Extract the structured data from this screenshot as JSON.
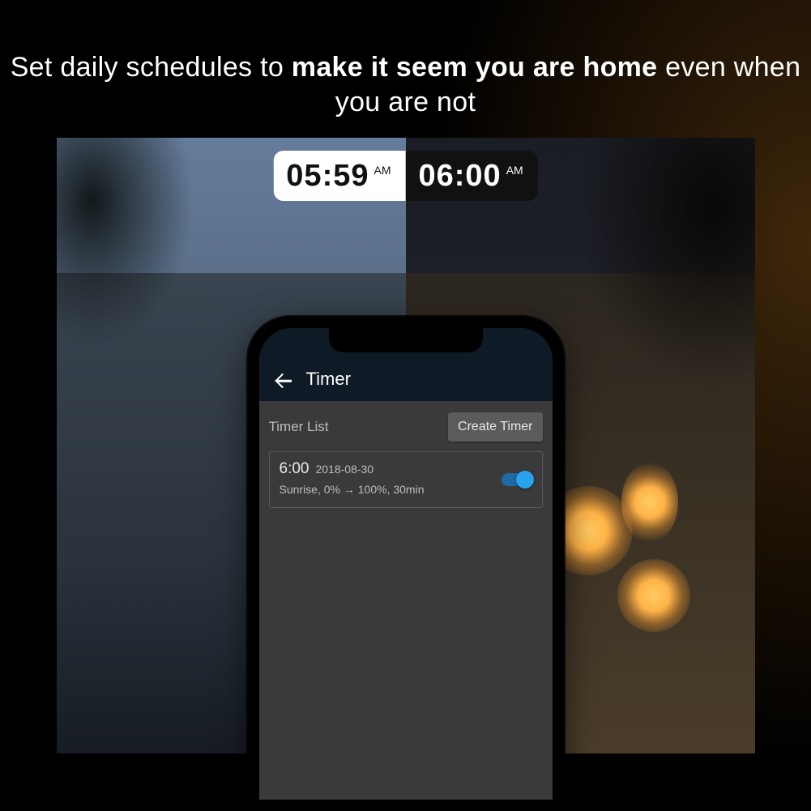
{
  "headline": {
    "part1": "Set daily schedules to ",
    "bold": "make it seem you are home",
    "part2": " even when you are not"
  },
  "time_pill": {
    "left": {
      "time": "05:59",
      "meridiem": "AM"
    },
    "right": {
      "time": "06:00",
      "meridiem": "AM"
    }
  },
  "phone": {
    "appbar": {
      "title": "Timer"
    },
    "section_label": "Timer List",
    "create_button": "Create Timer",
    "timers": [
      {
        "time": "6:00",
        "date": "2018-08-30",
        "detail": "Sunrise, 0% → 100%, 30min",
        "enabled": true
      }
    ]
  }
}
